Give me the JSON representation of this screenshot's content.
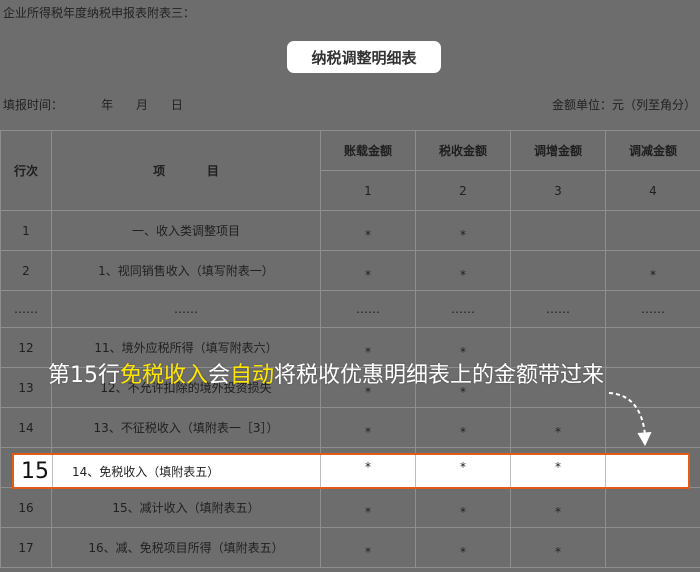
{
  "top_note": "企业所得税年度纳税申报表附表三：",
  "title": "纳税调整明细表",
  "meta": {
    "report_time": "填报时间：          年      月      日",
    "unit": "金额单位：元（列至角分）"
  },
  "table": {
    "headers": {
      "row_no": "行次",
      "item": "项          目",
      "col1": "账载金额",
      "col2": "税收金额",
      "col3": "调增金额",
      "col4": "调减金额",
      "n1": "1",
      "n2": "2",
      "n3": "3",
      "n4": "4"
    },
    "rows": [
      {
        "no": "1",
        "item": "一、收入类调整项目",
        "c1": "*",
        "c2": "*",
        "c3": "",
        "c4": ""
      },
      {
        "no": "2",
        "item": "1、视同销售收入（填写附表一）",
        "c1": "*",
        "c2": "*",
        "c3": "",
        "c4": "*"
      },
      {
        "no": "……",
        "item": "……",
        "c1": "……",
        "c2": "……",
        "c3": "……",
        "c4": "……"
      },
      {
        "no": "12",
        "item": "11、境外应税所得（填写附表六）",
        "c1": "*",
        "c2": "*",
        "c3": "",
        "c4": ""
      },
      {
        "no": "13",
        "item": "12、不允许扣除的境外投资损失",
        "c1": "*",
        "c2": "*",
        "c3": "",
        "c4": ""
      },
      {
        "no": "14",
        "item": "13、不征税收入（填附表一［3］）",
        "c1": "*",
        "c2": "*",
        "c3": "*",
        "c4": ""
      },
      {
        "no": "15",
        "item": "14、免税收入（填附表五）",
        "c1": "*",
        "c2": "*",
        "c3": "*",
        "c4": ""
      },
      {
        "no": "16",
        "item": "15、减计收入（填附表五）",
        "c1": "*",
        "c2": "*",
        "c3": "*",
        "c4": ""
      },
      {
        "no": "17",
        "item": "16、减、免税项目所得（填附表五）",
        "c1": "*",
        "c2": "*",
        "c3": "*",
        "c4": ""
      }
    ]
  },
  "annotation": {
    "part1": "第15行",
    "part2": "免税收入",
    "part3": "会",
    "part4": "自动",
    "part5": "将税收优惠明细表上的金额带过来",
    "highlight_color": "#ffe600",
    "border_color": "#e35c14",
    "arrow_icon": "dashed-curved-arrow-icon"
  }
}
